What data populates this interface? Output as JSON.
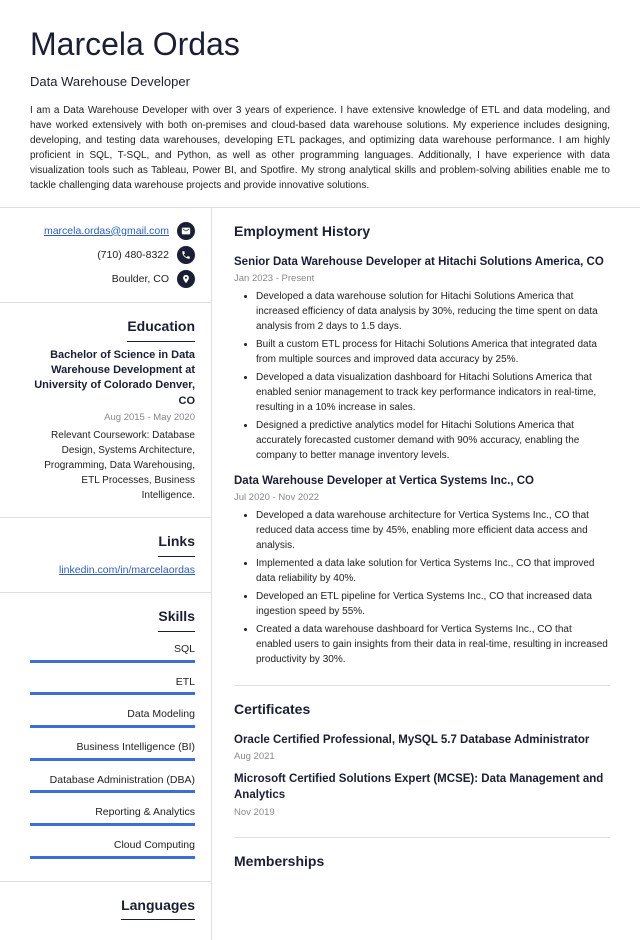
{
  "header": {
    "name": "Marcela Ordas",
    "title": "Data Warehouse Developer",
    "summary": "I am a Data Warehouse Developer with over 3 years of experience. I have extensive knowledge of ETL and data modeling, and have worked extensively with both on-premises and cloud-based data warehouse solutions. My experience includes designing, developing, and testing data warehouses, developing ETL packages, and optimizing data warehouse performance. I am highly proficient in SQL, T-SQL, and Python, as well as other programming languages. Additionally, I have experience with data visualization tools such as Tableau, Power BI, and Spotfire. My strong analytical skills and problem-solving abilities enable me to tackle challenging data warehouse projects and provide innovative solutions."
  },
  "contact": {
    "email": "marcela.ordas@gmail.com",
    "phone": "(710) 480-8322",
    "location": "Boulder, CO"
  },
  "education": {
    "heading": "Education",
    "degree": "Bachelor of Science in Data Warehouse Development at University of Colorado Denver, CO",
    "dates": "Aug 2015 - May 2020",
    "body": "Relevant Coursework: Database Design, Systems Architecture, Programming, Data Warehousing, ETL Processes, Business Intelligence."
  },
  "links": {
    "heading": "Links",
    "url": "linkedin.com/in/marcelaordas"
  },
  "skills": {
    "heading": "Skills",
    "items": [
      "SQL",
      "ETL",
      "Data Modeling",
      "Business Intelligence (BI)",
      "Database Administration (DBA)",
      "Reporting & Analytics",
      "Cloud Computing"
    ]
  },
  "languages": {
    "heading": "Languages"
  },
  "employment": {
    "heading": "Employment History",
    "jobs": [
      {
        "title": "Senior Data Warehouse Developer at Hitachi Solutions America, CO",
        "dates": "Jan 2023 - Present",
        "bullets": [
          "Developed a data warehouse solution for Hitachi Solutions America that increased efficiency of data analysis by 30%, reducing the time spent on data analysis from 2 days to 1.5 days.",
          "Built a custom ETL process for Hitachi Solutions America that integrated data from multiple sources and improved data accuracy by 25%.",
          "Developed a data visualization dashboard for Hitachi Solutions America that enabled senior management to track key performance indicators in real-time, resulting in a 10% increase in sales.",
          "Designed a predictive analytics model for Hitachi Solutions America that accurately forecasted customer demand with 90% accuracy, enabling the company to better manage inventory levels."
        ]
      },
      {
        "title": "Data Warehouse Developer at Vertica Systems Inc., CO",
        "dates": "Jul 2020 - Nov 2022",
        "bullets": [
          "Developed a data warehouse architecture for Vertica Systems Inc., CO that reduced data access time by 45%, enabling more efficient data access and analysis.",
          "Implemented a data lake solution for Vertica Systems Inc., CO that improved data reliability by 40%.",
          "Developed an ETL pipeline for Vertica Systems Inc., CO that increased data ingestion speed by 55%.",
          "Created a data warehouse dashboard for Vertica Systems Inc., CO that enabled users to gain insights from their data in real-time, resulting in increased productivity by 30%."
        ]
      }
    ]
  },
  "certificates": {
    "heading": "Certificates",
    "items": [
      {
        "title": "Oracle Certified Professional, MySQL 5.7 Database Administrator",
        "date": "Aug 2021"
      },
      {
        "title": "Microsoft Certified Solutions Expert (MCSE): Data Management and Analytics",
        "date": "Nov 2019"
      }
    ]
  },
  "memberships": {
    "heading": "Memberships"
  }
}
